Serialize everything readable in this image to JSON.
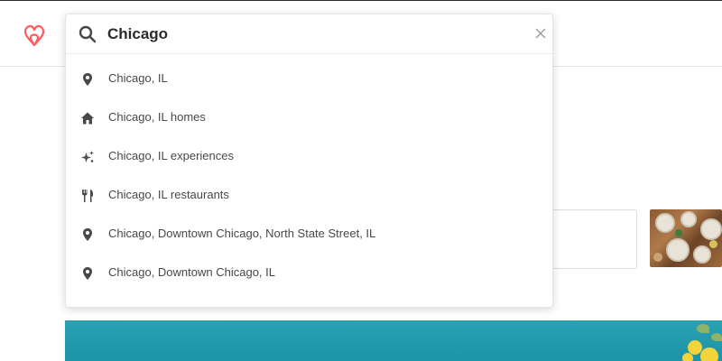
{
  "search": {
    "value": "Chicago",
    "icon": "search-icon",
    "clear_icon": "close-icon"
  },
  "suggestions": [
    {
      "label": "Chicago, IL",
      "icon": "location-pin-icon"
    },
    {
      "label": "Chicago, IL homes",
      "icon": "home-icon"
    },
    {
      "label": "Chicago, IL experiences",
      "icon": "sparkle-icon"
    },
    {
      "label": "Chicago, IL restaurants",
      "icon": "fork-knife-icon"
    },
    {
      "label": "Chicago, Downtown Chicago, North State Street, IL",
      "icon": "location-pin-icon"
    },
    {
      "label": "Chicago, Downtown Chicago, IL",
      "icon": "location-pin-icon"
    }
  ],
  "colors": {
    "brand": "#ff5a5f",
    "text": "#484848",
    "icon": "#484848",
    "banner": "#1d93a7"
  }
}
